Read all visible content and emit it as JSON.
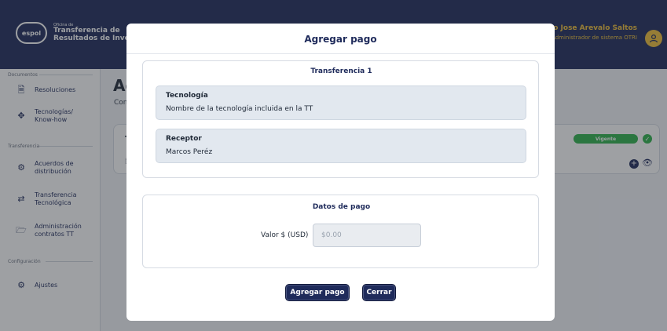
{
  "header": {
    "logo_text": "espol",
    "brand_small": "Oficina de",
    "brand_line1": "Transferencia de",
    "brand_line2": "Resultados de Investigación",
    "user_name": "Guillermo Jose Arevalo Saltos",
    "user_role": "Administrador de sistema OTRI"
  },
  "sidebar": {
    "sections": [
      {
        "label": "Documentos"
      },
      {
        "label": "Transferencia"
      },
      {
        "label": "Configuración"
      }
    ],
    "items": [
      {
        "label": "Resoluciones",
        "icon": "document-icon"
      },
      {
        "label": "Tecnologías/ Know-how",
        "icon": "tech-icon"
      },
      {
        "label": "Acuerdos de distribución",
        "icon": "agreement-icon"
      },
      {
        "label": "Transferencia Tecnológica",
        "icon": "transfer-arrows-icon"
      },
      {
        "label": "Administración contratos TT",
        "icon": "folder-icon"
      },
      {
        "label": "Ajustes",
        "icon": "gear-icon"
      }
    ]
  },
  "main": {
    "title": "Ac",
    "subtitle": "Con",
    "card": {
      "title": "T",
      "status": "Vigente"
    }
  },
  "modal": {
    "title": "Agregar pago",
    "transfer": {
      "title": "Transferencia 1",
      "tecnologia_label": "Tecnología",
      "tecnologia_value": "Nombre de la tecnología incluida en la TT",
      "receptor_label": "Receptor",
      "receptor_value": "Marcos Peréz"
    },
    "payment": {
      "title": "Datos de pago",
      "value_label": "Valor $ (USD)",
      "value": "",
      "placeholder": "$0.00"
    },
    "buttons": {
      "add": "Agregar pago",
      "close": "Cerrar"
    }
  },
  "colors": {
    "primary": "#1f2b5b",
    "accent": "#f0c03a",
    "success": "#2fb24b"
  }
}
